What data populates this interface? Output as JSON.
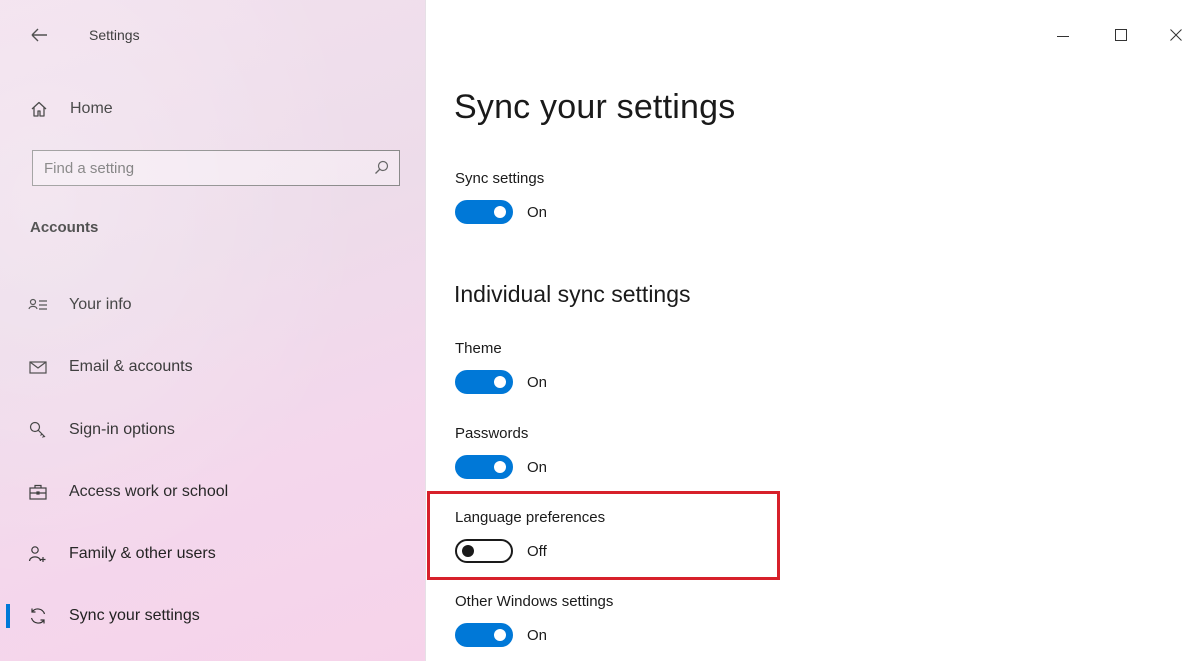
{
  "window": {
    "title": "Settings",
    "controls": {
      "minimize": "minimize-icon",
      "maximize": "maximize-icon",
      "close": "close-icon"
    }
  },
  "sidebar": {
    "home_label": "Home",
    "search_placeholder": "Find a setting",
    "section_heading": "Accounts",
    "items": [
      {
        "label": "Your info",
        "icon": "person-lines-icon",
        "active": false
      },
      {
        "label": "Email & accounts",
        "icon": "mail-icon",
        "active": false
      },
      {
        "label": "Sign-in options",
        "icon": "key-icon",
        "active": false
      },
      {
        "label": "Access work or school",
        "icon": "briefcase-icon",
        "active": false
      },
      {
        "label": "Family & other users",
        "icon": "add-person-icon",
        "active": false
      },
      {
        "label": "Sync your settings",
        "icon": "sync-icon",
        "active": true
      }
    ]
  },
  "main": {
    "title": "Sync your settings",
    "sync_settings": {
      "label": "Sync settings",
      "state": "On",
      "on": true
    },
    "individual_heading": "Individual sync settings",
    "settings": [
      {
        "label": "Theme",
        "state": "On",
        "on": true
      },
      {
        "label": "Passwords",
        "state": "On",
        "on": true
      },
      {
        "label": "Language preferences",
        "state": "Off",
        "on": false,
        "highlighted": true
      },
      {
        "label": "Other Windows settings",
        "state": "On",
        "on": true
      }
    ]
  },
  "colors": {
    "accent": "#0078d7",
    "highlight": "#d7202a",
    "sidebar_tint": "#f2dcec"
  }
}
